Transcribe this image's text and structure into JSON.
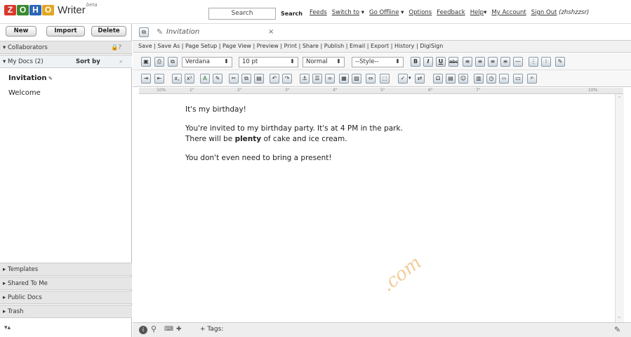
{
  "logo": {
    "letters": [
      "Z",
      "O",
      "H",
      "O"
    ],
    "colors": [
      "#d83a2e",
      "#3a8a2e",
      "#2c66b8",
      "#e2a623"
    ],
    "word": "Writer",
    "beta": "beta"
  },
  "top": {
    "search_value": "Search",
    "search_button": "Search",
    "links": [
      "Feeds",
      "Switch to",
      "Go Offline",
      "Options",
      "Feedback",
      "Help",
      "My Account",
      "Sign Out"
    ],
    "user": "(zhshzzsr)"
  },
  "sidebar": {
    "buttons": [
      "New",
      "Import",
      "Delete"
    ],
    "collaborators": "Collaborators",
    "my_docs": "My Docs (2)",
    "sort_by": "Sort by",
    "docs": [
      "Invitation",
      "Welcome"
    ],
    "sections": [
      "Templates",
      "Shared To Me",
      "Public Docs",
      "Trash"
    ]
  },
  "tab": {
    "title": "Invitation"
  },
  "menu": [
    "Save",
    "Save As",
    "Page Setup",
    "Page View",
    "Preview",
    "Print",
    "Share",
    "Publish",
    "Email",
    "Export",
    "History",
    "DigiSign"
  ],
  "toolbar": {
    "font": "Verdana",
    "size": "10 pt",
    "style_normal": "Normal",
    "style_select": "--Style--"
  },
  "ruler": {
    "left_label": "10%",
    "right_label": "10%",
    "ticks": [
      "1\"",
      "2\"",
      "3\"",
      "4\"",
      "5\"",
      "6\"",
      "7\""
    ]
  },
  "document": {
    "line1": "It's my birthday!",
    "line2": "You're invited to my birthday party. It's at 4 PM in the park.",
    "line3_pre": "There will be ",
    "line3_bold": "plenty",
    "line3_post": " of cake and ice cream.",
    "line4": "You don't even need to bring a present!"
  },
  "status": {
    "tags_label": "+ Tags:"
  },
  "watermark": ".com"
}
